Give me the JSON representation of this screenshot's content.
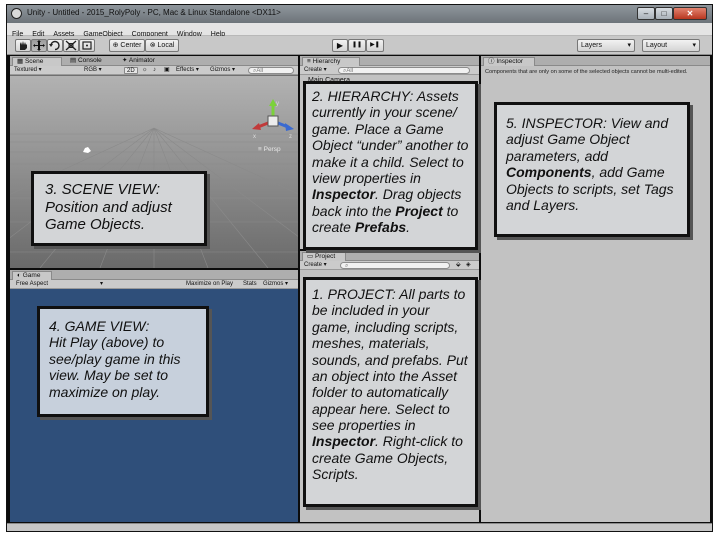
{
  "window": {
    "title": "Unity - Untitled - 2015_RolyPoly - PC, Mac & Linux Standalone <DX11>",
    "min_glyph": "–",
    "max_glyph": "□",
    "close_glyph": "✕"
  },
  "menu": [
    "File",
    "Edit",
    "Assets",
    "GameObject",
    "Component",
    "Window",
    "Help"
  ],
  "toolbar": {
    "pivot": "Center",
    "space": "Local",
    "play_glyph": "▶",
    "pause_glyph": "❚❚",
    "step_glyph": "▶❚",
    "layers": "Layers",
    "layout": "Layout"
  },
  "scene_panel": {
    "tabs": [
      "Scene",
      "Console",
      "Animator"
    ],
    "draw_mode": "Textured",
    "render_mode": "RGB",
    "mode_2d": "2D",
    "effects": "Effects",
    "gizmos": "Gizmos",
    "search_placeholder": "All",
    "persp_label": "Persp",
    "gizmo_axes": {
      "y": "y",
      "x": "x",
      "z": "z"
    }
  },
  "game_panel": {
    "tab": "Game",
    "aspect": "Free Aspect",
    "maximize": "Maximize on Play",
    "stats": "Stats",
    "gizmos": "Gizmos"
  },
  "hierarchy_panel": {
    "tab": "Hierarchy",
    "create": "Create",
    "search_placeholder": "All",
    "items": [
      "Main Camera"
    ]
  },
  "project_panel": {
    "tab": "Project",
    "create": "Create"
  },
  "inspector_panel": {
    "tab": "Inspector",
    "message": "Components that are only on some of the selected objects cannot be multi-edited."
  },
  "callouts": {
    "scene": {
      "heading": "3. SCENE VIEW:",
      "body": "Position and adjust Game Objects."
    },
    "game": {
      "heading": "4. GAME VIEW:",
      "body": "Hit Play (above) to see/play game  in this view. May be set to maximize on play."
    },
    "hierarchy": {
      "heading": "2. HIERARCHY:",
      "text1": " Assets currently in your scene/ game. Place a Game Object “under” another to make it a child. Select to view properties in ",
      "bold1": "Inspector",
      "text2": ". Drag objects back into the ",
      "bold2": "Project",
      "text3": " to create ",
      "bold3": "Prefabs",
      "text4": "."
    },
    "project": {
      "heading": "1. PROJECT:",
      "text1": " All parts to be included in your game, including scripts, meshes, materials, sounds, and prefabs. Put an object into the Asset folder to automatically appear here. Select to see properties in ",
      "bold1": "Inspector",
      "text2": ". Right-click to create Game Objects, Scripts."
    },
    "inspector": {
      "heading": "5. INSPECTOR:",
      "text1": " View and adjust Game Object parameters, add ",
      "bold1": "Components",
      "text2": ", add Game Objects to scripts, set Tags and Layers."
    }
  }
}
